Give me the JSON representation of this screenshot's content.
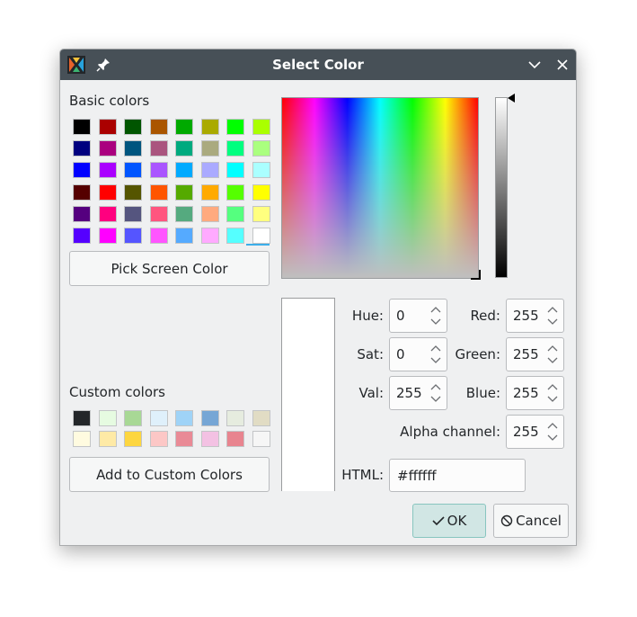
{
  "window": {
    "title": "Select Color"
  },
  "basic_colors": {
    "label": "Basic colors",
    "swatches": [
      "#000000",
      "#aa0000",
      "#005500",
      "#aa5500",
      "#00aa00",
      "#aaaa00",
      "#00ff00",
      "#aaff00",
      "#00007f",
      "#aa007f",
      "#00557f",
      "#aa557f",
      "#00aa7f",
      "#aaaa7f",
      "#00ff7f",
      "#aaff7f",
      "#0000ff",
      "#aa00ff",
      "#0055ff",
      "#aa55ff",
      "#00aaff",
      "#aaaaff",
      "#00ffff",
      "#aaffff",
      "#550000",
      "#ff0000",
      "#555500",
      "#ff5500",
      "#55aa00",
      "#ffaa00",
      "#55ff00",
      "#ffff00",
      "#55007f",
      "#ff007f",
      "#55557f",
      "#ff557f",
      "#55aa7f",
      "#ffaa7f",
      "#55ff7f",
      "#ffff7f",
      "#5500ff",
      "#ff00ff",
      "#5555ff",
      "#ff55ff",
      "#55aaff",
      "#ffaaff",
      "#55ffff",
      "#ffffff"
    ]
  },
  "pick_screen_color_label": "Pick Screen Color",
  "custom_colors": {
    "label": "Custom colors",
    "swatches": [
      "#232629",
      "#e6fbe1",
      "#a8d895",
      "#dff0fb",
      "#9fd3f7",
      "#76a6d5",
      "#e6ecdf",
      "#e1dcc4",
      "#fffbe0",
      "#feeaa6",
      "#fdd640",
      "#fcc7c6",
      "#e98a96",
      "#f3c1e3",
      "#e8848f",
      "#f6f6f6"
    ]
  },
  "add_custom_label": "Add to Custom Colors",
  "fields": {
    "hue": {
      "label": "Hue:",
      "value": "0"
    },
    "sat": {
      "label": "Sat:",
      "value": "0"
    },
    "val": {
      "label": "Val:",
      "value": "255"
    },
    "red": {
      "label": "Red:",
      "value": "255"
    },
    "green": {
      "label": "Green:",
      "value": "255"
    },
    "blue": {
      "label": "Blue:",
      "value": "255"
    },
    "alpha": {
      "label": "Alpha channel:",
      "value": "255"
    },
    "html": {
      "label": "HTML:",
      "value": "#ffffff"
    }
  },
  "buttons": {
    "ok": "OK",
    "cancel": "Cancel"
  },
  "colors": {
    "accent": "#3daee9",
    "ok_bg": "#d1e6e4",
    "titlebar": "#475057",
    "window_bg": "#eff0f1",
    "selected_color": "#ffffff"
  },
  "icons": {
    "app": "app-icon",
    "pin": "pin-icon",
    "minimize": "chevron-down-icon",
    "close": "close-icon",
    "ok": "checkmark-icon",
    "cancel": "cancel-icon"
  }
}
